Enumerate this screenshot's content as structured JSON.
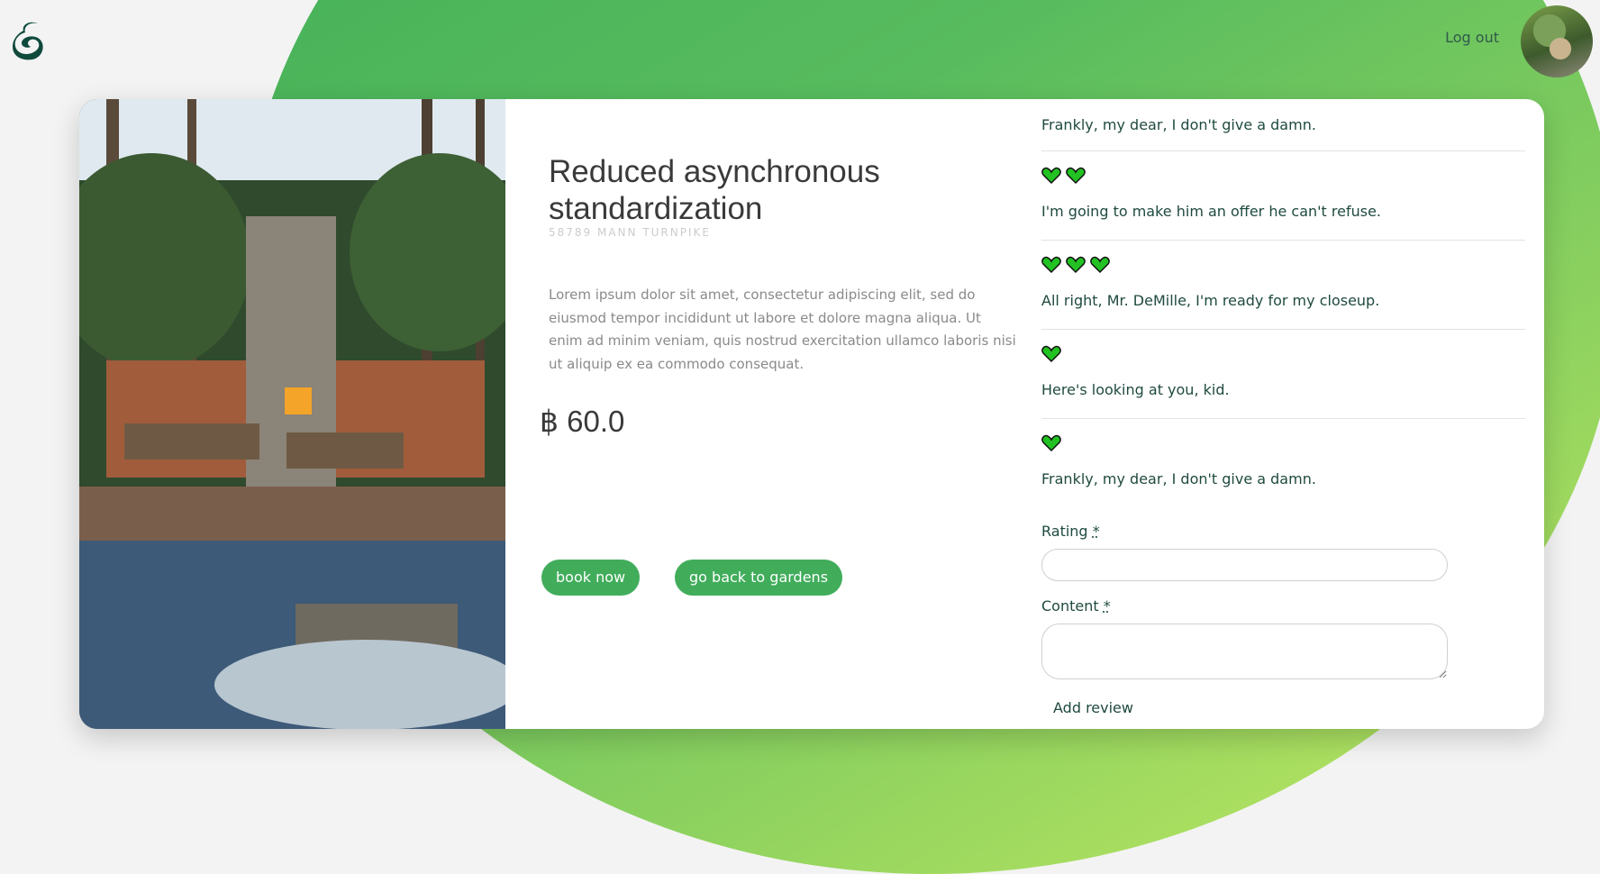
{
  "header": {
    "logout_label": "Log out"
  },
  "listing": {
    "title": "Reduced asynchronous standardization",
    "address": "58789 MANN TURNPIKE",
    "description": "Lorem ipsum dolor sit amet, consectetur adipiscing elit, sed do eiusmod tempor incididunt ut labore et dolore magna aliqua. Ut enim ad minim veniam, quis nostrud exercitation ullamco laboris nisi ut aliquip ex ea commodo consequat.",
    "price": "฿ 60.0",
    "book_label": "book now",
    "back_label": "go back to gardens"
  },
  "reviews": [
    {
      "hearts": 0,
      "text": "Frankly, my dear, I don't give a damn."
    },
    {
      "hearts": 2,
      "text": "I'm going to make him an offer he can't refuse."
    },
    {
      "hearts": 3,
      "text": "All right, Mr. DeMille, I'm ready for my closeup."
    },
    {
      "hearts": 1,
      "text": "Here's looking at you, kid."
    },
    {
      "hearts": 1,
      "text": "Frankly, my dear, I don't give a damn."
    }
  ],
  "form": {
    "rating_label": "Rating",
    "content_label": "Content",
    "required_mark": "*",
    "submit_label": "Add review"
  },
  "colors": {
    "accent": "#41ad5b",
    "heart": "#22c222",
    "brand_dark": "#0f4a3c"
  }
}
